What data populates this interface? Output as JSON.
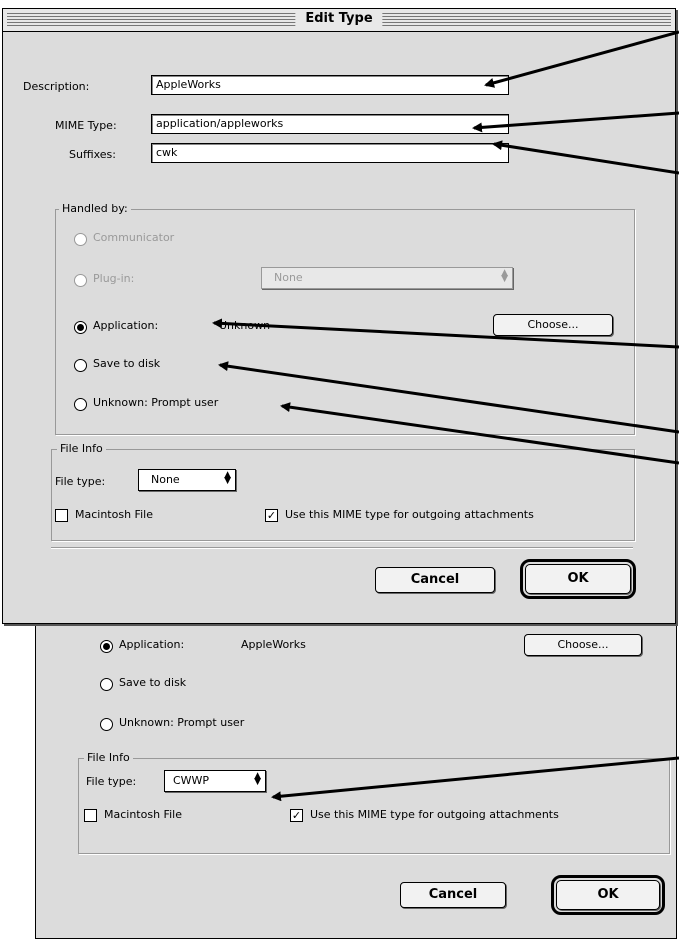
{
  "dialog": {
    "title": "Edit Type",
    "description_label": "Description:",
    "description_value": "AppleWorks",
    "mime_label": "MIME Type:",
    "mime_value": "application/appleworks",
    "suffixes_label": "Suffixes:",
    "suffixes_value": "cwk",
    "handled_by": {
      "label": "Handled by:",
      "communicator_label": "Communicator",
      "plugin_label": "Plug-in:",
      "plugin_value": "None",
      "application_label": "Application:",
      "application_value": "Unknown",
      "choose_label": "Choose...",
      "save_label": "Save to disk",
      "unknown_label": "Unknown: Prompt user"
    },
    "file_info": {
      "label": "File Info",
      "file_type_label": "File type:",
      "file_type_value": "None",
      "macintosh_label": "Macintosh File",
      "mime_outgoing_label": "Use this MIME type for outgoing attachments",
      "mime_outgoing_checked": true,
      "macintosh_checked": false
    },
    "cancel_label": "Cancel",
    "ok_label": "OK"
  },
  "dialog2": {
    "application_label": "Application:",
    "application_value": "AppleWorks",
    "choose_label": "Choose...",
    "save_label": "Save to disk",
    "unknown_label": "Unknown: Prompt user",
    "file_info_label": "File Info",
    "file_type_label": "File type:",
    "file_type_value": "CWWP",
    "macintosh_label": "Macintosh File",
    "mime_outgoing_label": "Use this MIME type for outgoing attachments",
    "cancel_label": "Cancel",
    "ok_label": "OK"
  },
  "colors": {
    "window_bg": "#dcdcdc",
    "disabled_text": "#9a9a9a"
  },
  "icons": [
    "radio-button",
    "checkbox-check",
    "popup-arrows",
    "callout-arrow"
  ]
}
